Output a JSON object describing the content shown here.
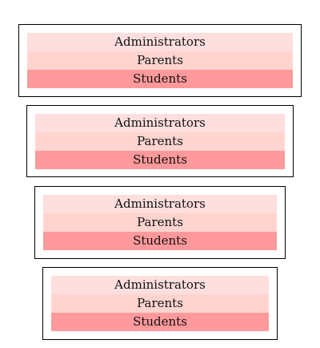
{
  "stacks": [
    {
      "rows": [
        {
          "label": "Administrators",
          "color": "#ffdede"
        },
        {
          "label": "Parents",
          "color": "#ffd4cf"
        },
        {
          "label": "Students",
          "color": "#ff999b"
        }
      ]
    },
    {
      "rows": [
        {
          "label": "Administrators",
          "color": "#ffdede"
        },
        {
          "label": "Parents",
          "color": "#ffd4cf"
        },
        {
          "label": "Students",
          "color": "#ff999b"
        }
      ]
    },
    {
      "rows": [
        {
          "label": "Administrators",
          "color": "#ffdede"
        },
        {
          "label": "Parents",
          "color": "#ffd4cf"
        },
        {
          "label": "Students",
          "color": "#ff999b"
        }
      ]
    },
    {
      "rows": [
        {
          "label": "Administrators",
          "color": "#ffdede"
        },
        {
          "label": "Parents",
          "color": "#ffd4cf"
        },
        {
          "label": "Students",
          "color": "#ff999b"
        }
      ]
    }
  ]
}
